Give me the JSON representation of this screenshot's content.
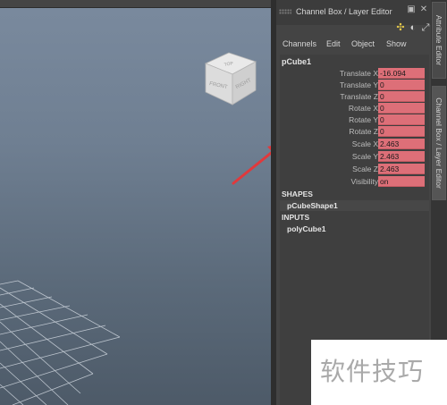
{
  "panel": {
    "title": "Channel Box / Layer Editor",
    "menus": [
      "Channels",
      "Edit",
      "Object",
      "Show"
    ]
  },
  "channel_box": {
    "object_name": "pCube1",
    "attributes": [
      {
        "label": "Translate X",
        "value": "-16.094"
      },
      {
        "label": "Translate Y",
        "value": "0"
      },
      {
        "label": "Translate Z",
        "value": "0"
      },
      {
        "label": "Rotate X",
        "value": "0"
      },
      {
        "label": "Rotate Y",
        "value": "0"
      },
      {
        "label": "Rotate Z",
        "value": "0"
      },
      {
        "label": "Scale X",
        "value": "2.463"
      },
      {
        "label": "Scale Y",
        "value": "2.463"
      },
      {
        "label": "Scale Z",
        "value": "2.463"
      },
      {
        "label": "Visibility",
        "value": "on"
      }
    ],
    "shapes_header": "SHAPES",
    "shape_item": "pCubeShape1",
    "inputs_header": "INPUTS",
    "input_item": "polyCube1"
  },
  "side_tabs": [
    "Attribute Editor",
    "Channel Box / Layer Editor"
  ],
  "viewcube": {
    "top": "TOP",
    "front": "FRONT",
    "right": "RIGHT"
  },
  "watermark": "软件技巧",
  "colors": {
    "attr_value_bg": "#dd6f78",
    "arrow": "#e0393c",
    "viewport_top": "#7a8a9e",
    "viewport_bottom": "#4d5a68"
  }
}
